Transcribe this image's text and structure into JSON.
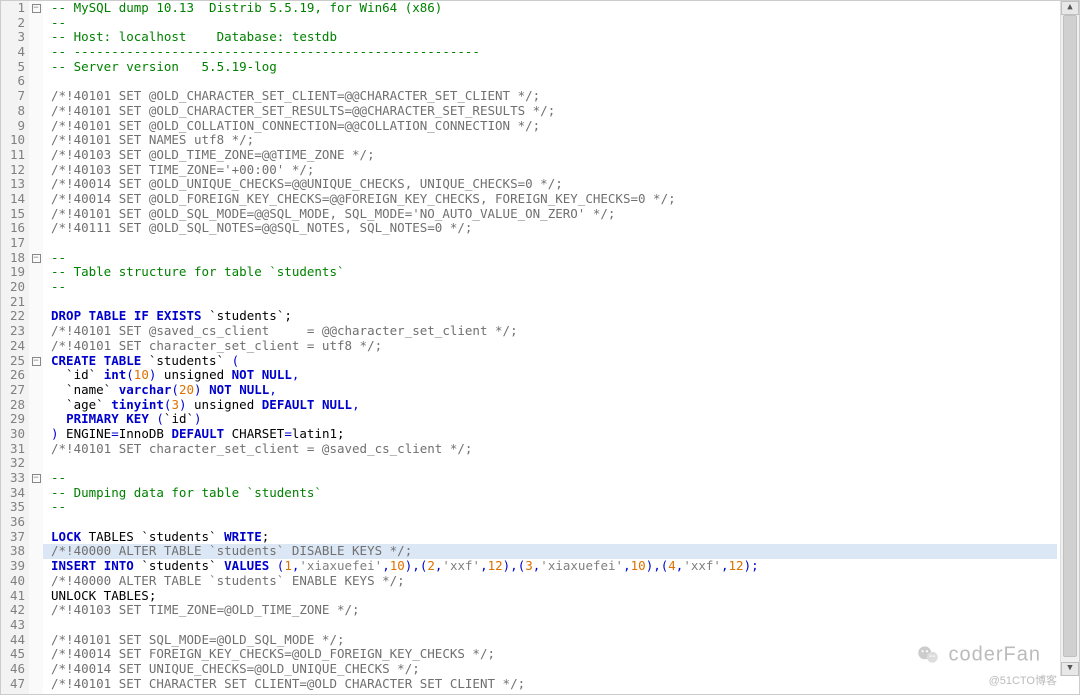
{
  "highlighted_line": 38,
  "lines": [
    {
      "n": 1,
      "fold": "open",
      "segs": [
        [
          "-- MySQL dump 10.13  Distrib 5.5.19, for Win64 (x86)",
          "c-comment"
        ]
      ]
    },
    {
      "n": 2,
      "segs": [
        [
          "--",
          "c-comment"
        ]
      ]
    },
    {
      "n": 3,
      "segs": [
        [
          "-- Host: localhost    Database: testdb",
          "c-comment"
        ]
      ]
    },
    {
      "n": 4,
      "segs": [
        [
          "-- ------------------------------------------------------",
          "c-comment"
        ]
      ]
    },
    {
      "n": 5,
      "segs": [
        [
          "-- Server version   5.5.19-log",
          "c-comment"
        ]
      ]
    },
    {
      "n": 6,
      "segs": []
    },
    {
      "n": 7,
      "segs": [
        [
          "/*!40101 SET @OLD_CHARACTER_SET_CLIENT=@@CHARACTER_SET_CLIENT */;",
          "c-gray"
        ]
      ]
    },
    {
      "n": 8,
      "segs": [
        [
          "/*!40101 SET @OLD_CHARACTER_SET_RESULTS=@@CHARACTER_SET_RESULTS */;",
          "c-gray"
        ]
      ]
    },
    {
      "n": 9,
      "segs": [
        [
          "/*!40101 SET @OLD_COLLATION_CONNECTION=@@COLLATION_CONNECTION */;",
          "c-gray"
        ]
      ]
    },
    {
      "n": 10,
      "segs": [
        [
          "/*!40101 SET NAMES utf8 */;",
          "c-gray"
        ]
      ]
    },
    {
      "n": 11,
      "segs": [
        [
          "/*!40103 SET @OLD_TIME_ZONE=@@TIME_ZONE */;",
          "c-gray"
        ]
      ]
    },
    {
      "n": 12,
      "segs": [
        [
          "/*!40103 SET TIME_ZONE='+00:00' */;",
          "c-gray"
        ]
      ]
    },
    {
      "n": 13,
      "segs": [
        [
          "/*!40014 SET @OLD_UNIQUE_CHECKS=@@UNIQUE_CHECKS, UNIQUE_CHECKS=0 */;",
          "c-gray"
        ]
      ]
    },
    {
      "n": 14,
      "segs": [
        [
          "/*!40014 SET @OLD_FOREIGN_KEY_CHECKS=@@FOREIGN_KEY_CHECKS, FOREIGN_KEY_CHECKS=0 */;",
          "c-gray"
        ]
      ]
    },
    {
      "n": 15,
      "segs": [
        [
          "/*!40101 SET @OLD_SQL_MODE=@@SQL_MODE, SQL_MODE='NO_AUTO_VALUE_ON_ZERO' */;",
          "c-gray"
        ]
      ]
    },
    {
      "n": 16,
      "segs": [
        [
          "/*!40111 SET @OLD_SQL_NOTES=@@SQL_NOTES, SQL_NOTES=0 */;",
          "c-gray"
        ]
      ]
    },
    {
      "n": 17,
      "segs": []
    },
    {
      "n": 18,
      "fold": "open",
      "segs": [
        [
          "--",
          "c-comment"
        ]
      ]
    },
    {
      "n": 19,
      "segs": [
        [
          "-- Table structure for table `students`",
          "c-comment"
        ]
      ]
    },
    {
      "n": 20,
      "segs": [
        [
          "--",
          "c-comment"
        ]
      ]
    },
    {
      "n": 21,
      "segs": []
    },
    {
      "n": 22,
      "segs": [
        [
          "DROP",
          "c-kw"
        ],
        [
          " ",
          ""
        ],
        [
          "TABLE",
          "c-kw"
        ],
        [
          " ",
          ""
        ],
        [
          "IF",
          "c-kw"
        ],
        [
          " ",
          ""
        ],
        [
          "EXISTS",
          "c-kw"
        ],
        [
          " `students`;",
          ""
        ]
      ]
    },
    {
      "n": 23,
      "segs": [
        [
          "/*!40101 SET @saved_cs_client     = @@character_set_client */;",
          "c-gray"
        ]
      ]
    },
    {
      "n": 24,
      "segs": [
        [
          "/*!40101 SET character_set_client = utf8 */;",
          "c-gray"
        ]
      ]
    },
    {
      "n": 25,
      "fold": "open",
      "segs": [
        [
          "CREATE",
          "c-kw"
        ],
        [
          " ",
          ""
        ],
        [
          "TABLE",
          "c-kw"
        ],
        [
          " `students` ",
          ""
        ],
        [
          "(",
          "c-kw2"
        ]
      ]
    },
    {
      "n": 26,
      "segs": [
        [
          "  `id` ",
          ""
        ],
        [
          "int",
          "c-kw"
        ],
        [
          "(",
          "c-kw2"
        ],
        [
          "10",
          "c-num"
        ],
        [
          ")",
          "c-kw2"
        ],
        [
          " unsigned ",
          ""
        ],
        [
          "NOT",
          "c-kw"
        ],
        [
          " ",
          ""
        ],
        [
          "NULL",
          "c-kw"
        ],
        [
          ",",
          "c-kw2"
        ]
      ]
    },
    {
      "n": 27,
      "segs": [
        [
          "  `name` ",
          ""
        ],
        [
          "varchar",
          "c-kw"
        ],
        [
          "(",
          "c-kw2"
        ],
        [
          "20",
          "c-num"
        ],
        [
          ")",
          "c-kw2"
        ],
        [
          " ",
          ""
        ],
        [
          "NOT",
          "c-kw"
        ],
        [
          " ",
          ""
        ],
        [
          "NULL",
          "c-kw"
        ],
        [
          ",",
          "c-kw2"
        ]
      ]
    },
    {
      "n": 28,
      "segs": [
        [
          "  `age` ",
          ""
        ],
        [
          "tinyint",
          "c-kw"
        ],
        [
          "(",
          "c-kw2"
        ],
        [
          "3",
          "c-num"
        ],
        [
          ")",
          "c-kw2"
        ],
        [
          " unsigned ",
          ""
        ],
        [
          "DEFAULT",
          "c-kw"
        ],
        [
          " ",
          ""
        ],
        [
          "NULL",
          "c-kw"
        ],
        [
          ",",
          "c-kw2"
        ]
      ]
    },
    {
      "n": 29,
      "segs": [
        [
          "  ",
          ""
        ],
        [
          "PRIMARY",
          "c-kw"
        ],
        [
          " ",
          ""
        ],
        [
          "KEY",
          "c-kw"
        ],
        [
          " ",
          ""
        ],
        [
          "(",
          "c-kw2"
        ],
        [
          "`id`",
          ""
        ],
        [
          ")",
          "c-kw2"
        ]
      ]
    },
    {
      "n": 30,
      "segs": [
        [
          ")",
          "c-kw2"
        ],
        [
          " ENGINE",
          ""
        ],
        [
          "=",
          "c-kw2"
        ],
        [
          "InnoDB ",
          ""
        ],
        [
          "DEFAULT",
          "c-kw"
        ],
        [
          " CHARSET",
          ""
        ],
        [
          "=",
          "c-kw2"
        ],
        [
          "latin1;",
          ""
        ]
      ]
    },
    {
      "n": 31,
      "segs": [
        [
          "/*!40101 SET character_set_client = @saved_cs_client */;",
          "c-gray"
        ]
      ]
    },
    {
      "n": 32,
      "segs": []
    },
    {
      "n": 33,
      "fold": "open",
      "segs": [
        [
          "--",
          "c-comment"
        ]
      ]
    },
    {
      "n": 34,
      "segs": [
        [
          "-- Dumping data for table `students`",
          "c-comment"
        ]
      ]
    },
    {
      "n": 35,
      "segs": [
        [
          "--",
          "c-comment"
        ]
      ]
    },
    {
      "n": 36,
      "segs": []
    },
    {
      "n": 37,
      "segs": [
        [
          "LOCK",
          "c-kw"
        ],
        [
          " TABLES `students` ",
          ""
        ],
        [
          "WRITE",
          "c-kw"
        ],
        [
          ";",
          ""
        ]
      ]
    },
    {
      "n": 38,
      "segs": [
        [
          "/*!40000 ALTER TABLE `students` DISABLE KEYS */;",
          "c-gray"
        ]
      ]
    },
    {
      "n": 39,
      "segs": [
        [
          "INSERT",
          "c-kw"
        ],
        [
          " ",
          ""
        ],
        [
          "INTO",
          "c-kw"
        ],
        [
          " `students` ",
          ""
        ],
        [
          "VALUES",
          "c-kw"
        ],
        [
          " ",
          ""
        ],
        [
          "(",
          "c-kw2"
        ],
        [
          "1",
          "c-num"
        ],
        [
          ",",
          "c-kw2"
        ],
        [
          "'xiaxuefei'",
          "c-quote"
        ],
        [
          ",",
          "c-kw2"
        ],
        [
          "10",
          "c-num"
        ],
        [
          "),(",
          "c-kw2"
        ],
        [
          "2",
          "c-num"
        ],
        [
          ",",
          "c-kw2"
        ],
        [
          "'xxf'",
          "c-quote"
        ],
        [
          ",",
          "c-kw2"
        ],
        [
          "12",
          "c-num"
        ],
        [
          "),(",
          "c-kw2"
        ],
        [
          "3",
          "c-num"
        ],
        [
          ",",
          "c-kw2"
        ],
        [
          "'xiaxuefei'",
          "c-quote"
        ],
        [
          ",",
          "c-kw2"
        ],
        [
          "10",
          "c-num"
        ],
        [
          "),(",
          "c-kw2"
        ],
        [
          "4",
          "c-num"
        ],
        [
          ",",
          "c-kw2"
        ],
        [
          "'xxf'",
          "c-quote"
        ],
        [
          ",",
          "c-kw2"
        ],
        [
          "12",
          "c-num"
        ],
        [
          ");",
          "c-kw2"
        ]
      ]
    },
    {
      "n": 40,
      "segs": [
        [
          "/*!40000 ALTER TABLE `students` ENABLE KEYS */;",
          "c-gray"
        ]
      ]
    },
    {
      "n": 41,
      "segs": [
        [
          "UNLOCK TABLES;",
          ""
        ]
      ]
    },
    {
      "n": 42,
      "segs": [
        [
          "/*!40103 SET TIME_ZONE=@OLD_TIME_ZONE */;",
          "c-gray"
        ]
      ]
    },
    {
      "n": 43,
      "segs": []
    },
    {
      "n": 44,
      "segs": [
        [
          "/*!40101 SET SQL_MODE=@OLD_SQL_MODE */;",
          "c-gray"
        ]
      ]
    },
    {
      "n": 45,
      "segs": [
        [
          "/*!40014 SET FOREIGN_KEY_CHECKS=@OLD_FOREIGN_KEY_CHECKS */;",
          "c-gray"
        ]
      ]
    },
    {
      "n": 46,
      "segs": [
        [
          "/*!40014 SET UNIQUE_CHECKS=@OLD_UNIQUE_CHECKS */;",
          "c-gray"
        ]
      ]
    },
    {
      "n": 47,
      "segs": [
        [
          "/*!40101 SET CHARACTER SET CLIENT=@OLD CHARACTER SET CLIENT */;",
          "c-gray"
        ]
      ]
    }
  ],
  "watermark": {
    "brand": "coderFan",
    "site": "@51CTO博客"
  }
}
